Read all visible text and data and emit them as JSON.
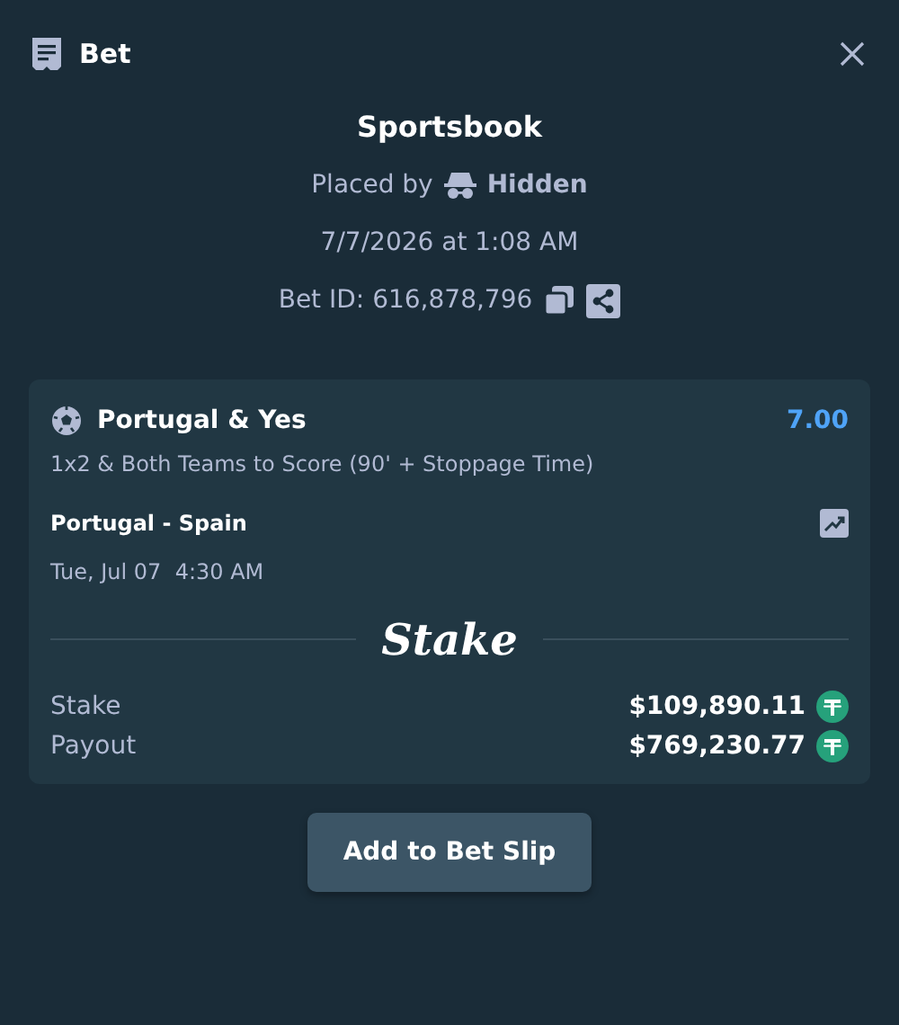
{
  "header": {
    "title": "Bet"
  },
  "summary": {
    "title": "Sportsbook",
    "placed_by_label": "Placed by",
    "placed_by_user": "Hidden",
    "datetime": "7/7/2026 at 1:08 AM",
    "bet_id": "Bet ID: 616,878,796"
  },
  "selection": {
    "name": "Portugal & Yes",
    "odds": "7.00",
    "market": "1x2 & Both Teams to Score (90' + Stoppage Time)",
    "event": "Portugal - Spain",
    "start": "Tue, Jul 07  4:30 AM"
  },
  "logo": "Stake",
  "amounts": [
    {
      "label": "Stake",
      "value": "$109,890.11"
    },
    {
      "label": "Payout",
      "value": "$769,230.77"
    }
  ],
  "button": "Add to Bet Slip"
}
